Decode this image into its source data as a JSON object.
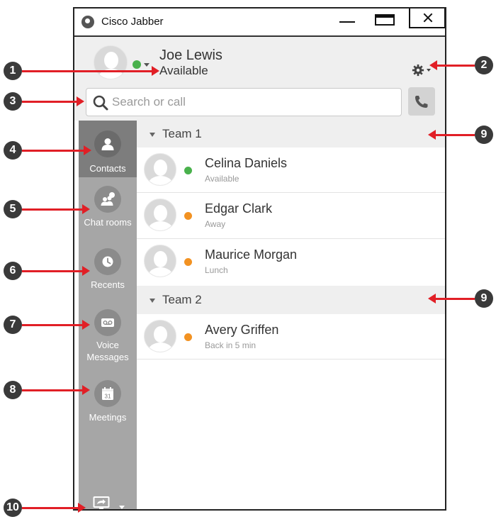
{
  "window": {
    "title": "Cisco Jabber"
  },
  "user": {
    "name": "Joe Lewis",
    "presence": "Available",
    "presence_color": "#49b14c"
  },
  "search": {
    "placeholder": "Search or call"
  },
  "sidebar": {
    "items": [
      {
        "label": "Contacts",
        "icon": "contacts-icon",
        "active": true
      },
      {
        "label": "Chat rooms",
        "icon": "chat-rooms-icon",
        "active": false
      },
      {
        "label": "Recents",
        "icon": "clock-icon",
        "active": false
      },
      {
        "label": "Voice Messages",
        "icon": "voicemail-icon",
        "active": false
      },
      {
        "label": "Meetings",
        "icon": "calendar-icon",
        "active": false,
        "calendar_day": "31"
      }
    ],
    "bottom_icon": "screen-share-icon"
  },
  "groups": [
    {
      "label": "Team 1",
      "contacts": [
        {
          "name": "Celina Daniels",
          "status": "Available",
          "status_color": "#49b14c"
        },
        {
          "name": "Edgar Clark",
          "status": "Away",
          "status_color": "#f29222"
        },
        {
          "name": "Maurice Morgan",
          "status": "Lunch",
          "status_color": "#f29222"
        }
      ]
    },
    {
      "label": "Team 2",
      "contacts": [
        {
          "name": "Avery Griffen",
          "status": "Back in 5 min",
          "status_color": "#f29222"
        }
      ]
    }
  ],
  "callouts": [
    "1",
    "2",
    "3",
    "4",
    "5",
    "6",
    "7",
    "8",
    "9",
    "9",
    "10"
  ],
  "colors": {
    "callout_arrow": "#e11f26",
    "callout_badge": "#3a3a3a",
    "sidebar": "#a6a6a6",
    "sidebar_active": "#7d7d7d"
  }
}
